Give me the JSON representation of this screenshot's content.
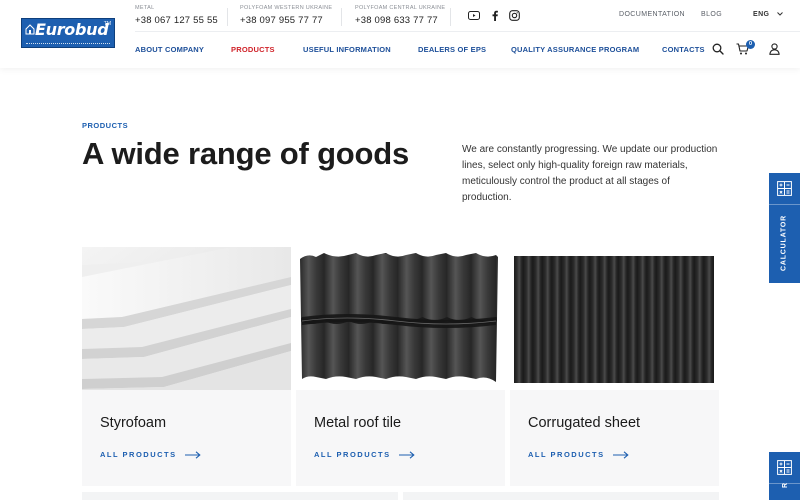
{
  "brand": {
    "name": "Eurobud",
    "tm": "TM"
  },
  "phones": [
    {
      "label": "METAL",
      "number": "+38 067 127 55 55"
    },
    {
      "label": "POLYFOAM WESTERN UKRAINE",
      "number": "+38 097 955 77 77"
    },
    {
      "label": "POLYFOAM CENTRAL UKRAINE",
      "number": "+38 098 633 77 77"
    }
  ],
  "social_icons": [
    "youtube-icon",
    "facebook-icon",
    "instagram-icon"
  ],
  "top_links": {
    "documentation": "DOCUMENTATION",
    "blog": "BLOG",
    "language": "ENG"
  },
  "nav": [
    {
      "label": "ABOUT COMPANY",
      "active": false
    },
    {
      "label": "PRODUCTS",
      "active": true
    },
    {
      "label": "USEFUL INFORMATION",
      "active": false
    },
    {
      "label": "DEALERS OF EPS",
      "active": false
    },
    {
      "label": "QUALITY ASSURANCE PROGRAM",
      "active": false
    },
    {
      "label": "CONTACTS",
      "active": false
    }
  ],
  "cart": {
    "count": "0"
  },
  "hero": {
    "eyebrow": "PRODUCTS",
    "title": "A wide range of goods",
    "description": "We are constantly progressing. We update our production lines, select only high-quality foreign raw materials, meticulously control the product at all stages of production."
  },
  "cards": [
    {
      "title": "Styrofoam",
      "link": "ALL PRODUCTS"
    },
    {
      "title": "Metal roof tile",
      "link": "ALL PRODUCTS"
    },
    {
      "title": "Corrugated sheet",
      "link": "ALL PRODUCTS"
    }
  ],
  "side_widget": {
    "label": "CALCULATOR",
    "label_partial": "R"
  },
  "colors": {
    "accent": "#1d5fb0",
    "active_nav": "#d0232a",
    "nav": "#1d4f99"
  }
}
